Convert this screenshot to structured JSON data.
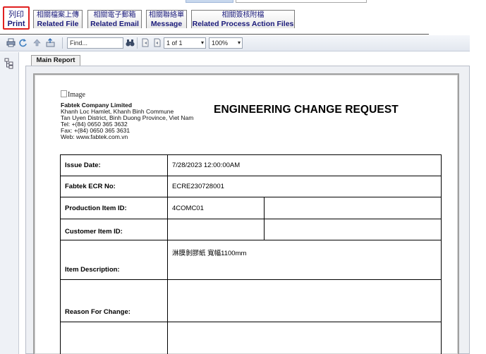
{
  "tabs": [
    {
      "zh": "列印",
      "en": "Print"
    },
    {
      "zh": "相關檔案上傳",
      "en": "Related File"
    },
    {
      "zh": "相關電子郵箱",
      "en": "Related Email"
    },
    {
      "zh": "相關聯絡單",
      "en": "Message"
    },
    {
      "zh": "相關簽核附檔",
      "en": "Related Process Action Files"
    }
  ],
  "toolbar": {
    "find_placeholder": "Find...",
    "page_value": "1 of 1",
    "zoom_value": "100%",
    "dropdown_arrow": "▾"
  },
  "report": {
    "tab_label": "Main Report",
    "image_alt": "Image",
    "company_name": "Fabtek Company Limited",
    "address_line1": "Khanh Loc Hamlet, Khanh Binh Commune",
    "address_line2": "Tan Uyen District, Binh Duong Province, Viet Nam",
    "tel": "Tel: +(84) 0650 365 3632",
    "fax": "Fax: +(84) 0650 365 3631",
    "web": "Web: www.fabtek.com.vn",
    "title": "ENGINEERING CHANGE REQUEST",
    "fields": {
      "issue_date_label": "Issue Date:",
      "issue_date_value": "7/28/2023  12:00:00AM",
      "ecr_no_label": "Fabtek ECR No:",
      "ecr_no_value": "ECRE230728001",
      "production_item_label": "Production Item ID:",
      "production_item_value": "4COMC01",
      "customer_item_label": "Customer Item ID:",
      "item_description_label": "Item Description:",
      "item_description_value": "淋膜剝膠紙 寬幅1100mm",
      "reason_label": "Reason For Change:"
    }
  },
  "icons": [
    "print-icon",
    "refresh-icon",
    "back-icon",
    "export-icon",
    "binoculars-icon",
    "first-page-icon",
    "prev-page-icon",
    "document-map-icon"
  ]
}
